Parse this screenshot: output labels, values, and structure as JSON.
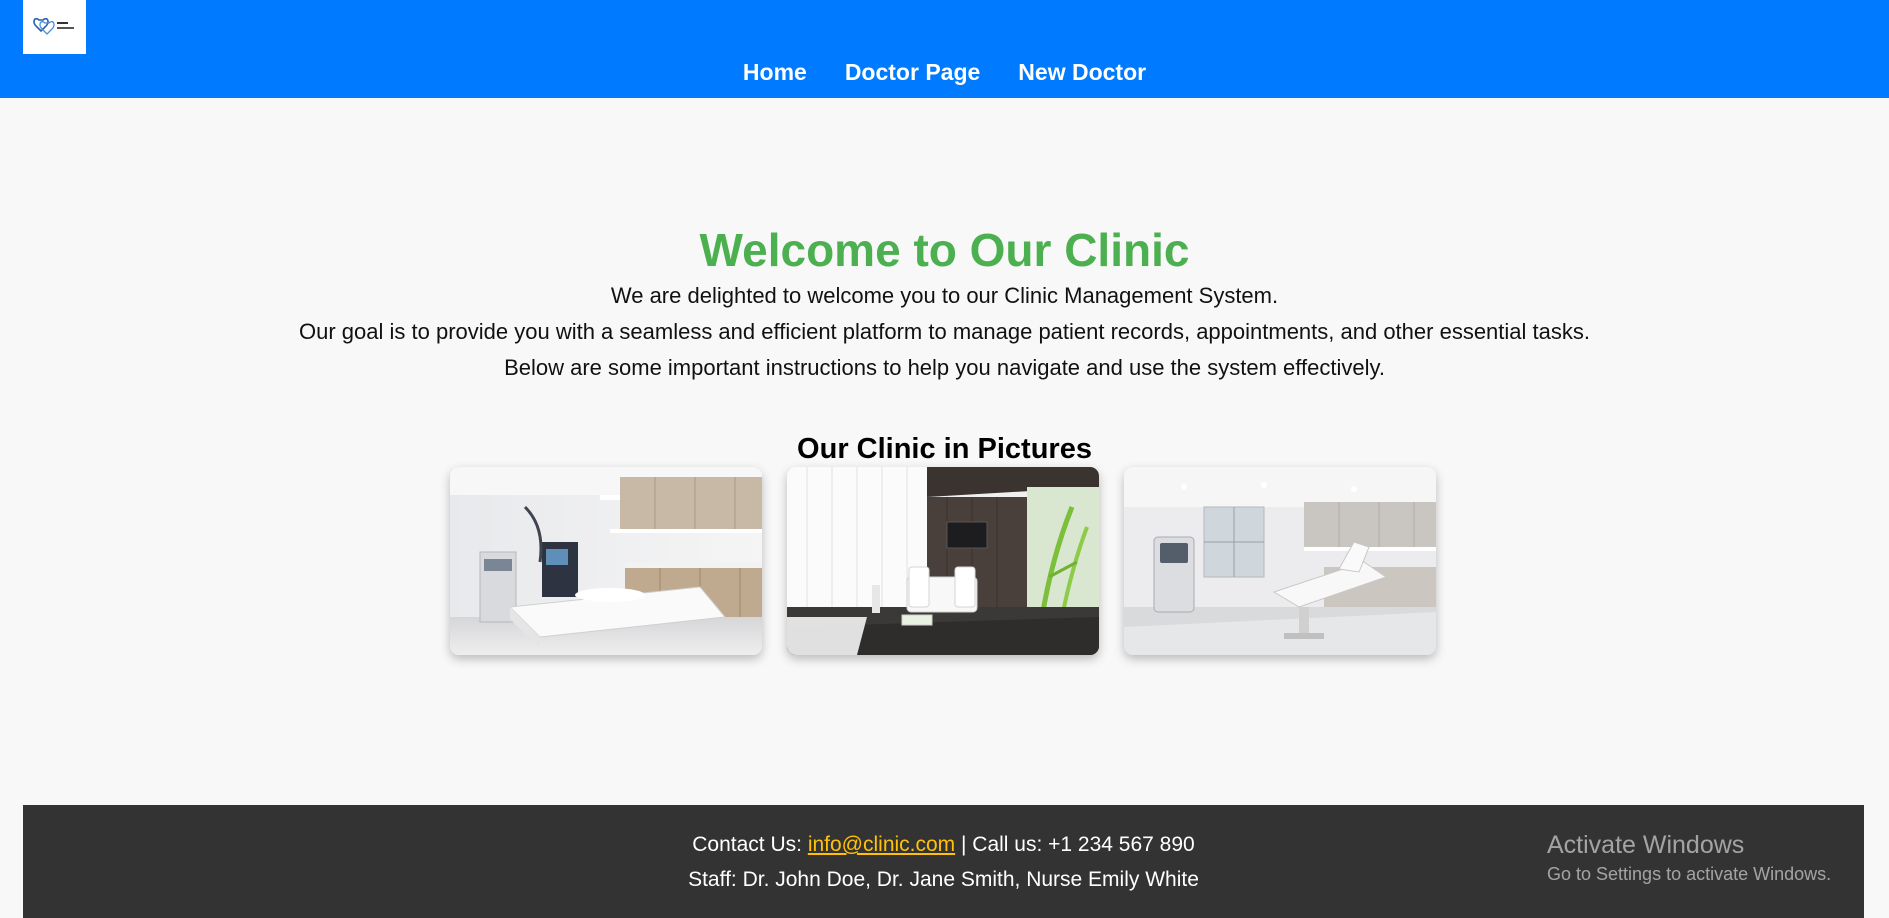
{
  "header": {
    "logo_name": "clinic-logo",
    "nav": [
      {
        "label": "Home"
      },
      {
        "label": "Doctor Page"
      },
      {
        "label": "New Doctor"
      }
    ]
  },
  "welcome": {
    "title": "Welcome to Our Clinic",
    "lines": [
      "We are delighted to welcome you to our Clinic Management System.",
      "Our goal is to provide you with a seamless and efficient platform to manage patient records, appointments, and other essential tasks.",
      "Below are some important instructions to help you navigate and use the system effectively."
    ]
  },
  "gallery": {
    "title": "Our Clinic in Pictures"
  },
  "footer": {
    "contact_prefix": "Contact Us: ",
    "email": "info@clinic.com",
    "call": " | Call us: +1 234 567 890",
    "staff": "Staff: Dr. John Doe, Dr. Jane Smith, Nurse Emily White"
  },
  "watermark": {
    "title": "Activate Windows",
    "subtitle": "Go to Settings to activate Windows."
  },
  "colors": {
    "primary": "#007bff",
    "heading_green": "#4caf50",
    "footer_bg": "#333333",
    "link_yellow": "#ffc107"
  }
}
